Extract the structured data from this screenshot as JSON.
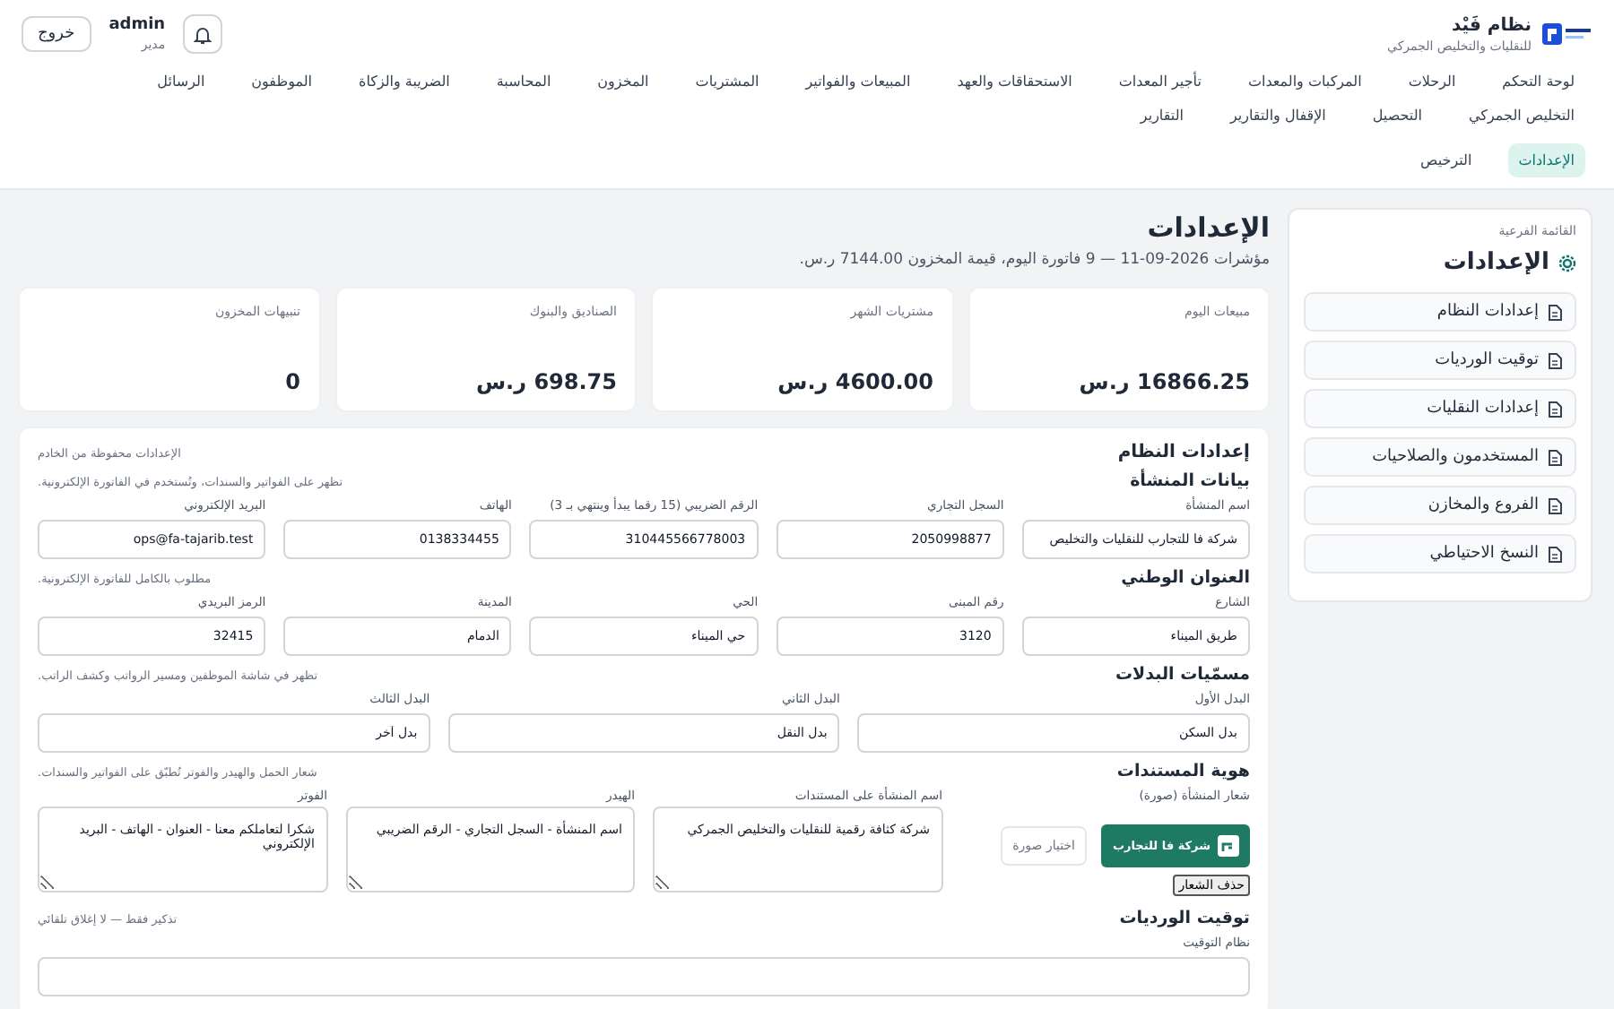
{
  "header": {
    "brand_title": "نظام فَيْد",
    "brand_subtitle": "للنقليات والتخليص الجمركي",
    "user_name": "admin",
    "user_role": "مدير",
    "logout": "خروج"
  },
  "nav": {
    "rows": [
      [
        {
          "label": "لوحة التحكم",
          "selected": false
        },
        {
          "label": "الرحلات",
          "selected": false
        },
        {
          "label": "المركبات والمعدات",
          "selected": false
        },
        {
          "label": "تأجير المعدات",
          "selected": false
        },
        {
          "label": "الاستحقاقات والعهد",
          "selected": false
        },
        {
          "label": "المبيعات والفواتير",
          "selected": false
        },
        {
          "label": "المشتريات",
          "selected": false
        },
        {
          "label": "المخزون",
          "selected": false
        },
        {
          "label": "المحاسبة",
          "selected": false
        },
        {
          "label": "الضريبة والزكاة",
          "selected": false
        },
        {
          "label": "الموظفون",
          "selected": false
        },
        {
          "label": "الرسائل",
          "selected": false
        },
        {
          "label": "التخليص الجمركي",
          "selected": false
        },
        {
          "label": "التحصيل",
          "selected": false
        },
        {
          "label": "الإقفال والتقارير",
          "selected": false
        },
        {
          "label": "التقارير",
          "selected": false
        }
      ],
      [
        {
          "label": "الإعدادات",
          "selected": true
        },
        {
          "label": "الترخيص",
          "selected": false
        }
      ]
    ]
  },
  "sidebar": {
    "caption": "القائمة الفرعية",
    "title": "الإعدادات",
    "items": [
      {
        "label": "إعدادات النظام"
      },
      {
        "label": "توقيت الورديات"
      },
      {
        "label": "إعدادات النقليات"
      },
      {
        "label": "المستخدمون والصلاحيات"
      },
      {
        "label": "الفروع والمخازن"
      },
      {
        "label": "النسخ الاحتياطي"
      }
    ]
  },
  "page": {
    "title": "الإعدادات",
    "subtitle": "مؤشرات 2026-09-11 — 9 فاتورة اليوم، قيمة المخزون 7144.00 ر.س."
  },
  "stats": [
    {
      "label": "مبيعات اليوم",
      "value": "16866.25 ر.س"
    },
    {
      "label": "مشتريات الشهر",
      "value": "4600.00 ر.س"
    },
    {
      "label": "الصناديق والبنوك",
      "value": "698.75 ر.س"
    },
    {
      "label": "تنبيهات المخزون",
      "value": "0"
    }
  ],
  "panel": {
    "title": "إعدادات النظام",
    "note": "الإعدادات محفوظة من الخادم",
    "sections": [
      {
        "kind": "fields",
        "title": "بيانات المنشأة",
        "note": "تظهر على الفواتير والسندات، وتُستخدم في الفاتورة الإلكترونية.",
        "fields": [
          {
            "label": "اسم المنشأة",
            "value": "شركة فا للتجارب للنقليات والتخليص"
          },
          {
            "label": "السجل التجاري",
            "value": "2050998877"
          },
          {
            "label": "الرقم الضريبي (15 رقما يبدأ وينتهي بـ 3)",
            "value": "310445566778003"
          },
          {
            "label": "الهاتف",
            "value": "0138334455"
          },
          {
            "label": "البريد الإلكتروني",
            "value": "ops@fa-tajarib.test"
          }
        ]
      },
      {
        "kind": "fields",
        "title": "العنوان الوطني",
        "note": "مطلوب بالكامل للفاتورة الإلكترونية.",
        "fields": [
          {
            "label": "الشارع",
            "value": "طريق الميناء"
          },
          {
            "label": "رقم المبنى",
            "value": "3120"
          },
          {
            "label": "الحي",
            "value": "حي الميناء"
          },
          {
            "label": "المدينة",
            "value": "الدمام"
          },
          {
            "label": "الرمز البريدي",
            "value": "32415"
          }
        ]
      },
      {
        "kind": "fields",
        "title": "مسمّيات البدلات",
        "note": "تظهر في شاشة الموظفين ومسير الرواتب وكشف الراتب.",
        "fields": [
          {
            "label": "البدل الأول",
            "value": "بدل السكن"
          },
          {
            "label": "البدل الثاني",
            "value": "بدل النقل"
          },
          {
            "label": "البدل الثالث",
            "value": "بدل آخر"
          }
        ]
      },
      {
        "kind": "identity",
        "title": "هوية المستندات",
        "note": "شعار الحمل والهيدر والفوتر تُطبّق على الفواتير والسندات.",
        "logo_label": "شعار المنشأة (صورة)",
        "logo_text": "شركة فا للتجارب",
        "choose_button": "اختيار صورة",
        "remove_button": "حذف الشعار",
        "fields": [
          {
            "label": "اسم المنشأة على المستندات",
            "value": "شركة كثافة رقمية للنقليات والتخليص الجمركي"
          },
          {
            "label": "الهيدر",
            "value": "اسم المنشأة - السجل التجاري - الرقم الضريبي"
          },
          {
            "label": "الفوتر",
            "value": "شكرا لتعاملكم معنا - العنوان - الهاتف - البريد الإلكتروني"
          }
        ]
      },
      {
        "kind": "fields",
        "title": "توقيت الورديات",
        "note": "تذكير فقط — لا إغلاق تلقائي",
        "fields": [
          {
            "label": "نظام التوقيت"
          }
        ]
      }
    ]
  }
}
